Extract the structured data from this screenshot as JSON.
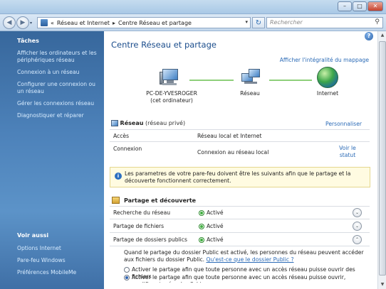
{
  "window": {
    "minimize_glyph": "–",
    "maximize_glyph": "□",
    "close_glyph": "✕"
  },
  "address": {
    "back_glyph": "◀",
    "forward_glyph": "▶",
    "overflow": "«",
    "crumbs": [
      "Réseau et Internet",
      "Centre Réseau et partage"
    ],
    "separator": "▸",
    "dropdown_glyph": "▾",
    "refresh_glyph": "↻",
    "search_placeholder": "Rechercher",
    "search_glyph": "⚲"
  },
  "sidebar": {
    "tasks_header": "Tâches",
    "tasks": [
      "Afficher les ordinateurs et les périphériques réseau",
      "Connexion à un réseau",
      "Configurer une connexion ou un réseau",
      "Gérer les connexions réseau",
      "Diagnostiquer et réparer"
    ],
    "see_also_header": "Voir aussi",
    "see_also": [
      "Options Internet",
      "Pare-feu Windows",
      "Préférences MobileMe"
    ]
  },
  "main": {
    "help_glyph": "?",
    "title": "Centre Réseau et partage",
    "view_full_map": "Afficher l'intégralité du mappage",
    "nodes": {
      "computer_name": "PC-DE-YVESROGER",
      "computer_sub": "(cet ordinateur)",
      "network": "Réseau",
      "internet": "Internet"
    },
    "network": {
      "name": "Réseau",
      "type": "(réseau privé)",
      "customize": "Personnaliser",
      "rows": [
        {
          "label": "Accès",
          "value": "Réseau local et Internet"
        },
        {
          "label": "Connexion",
          "value": "Connexion au réseau local"
        }
      ],
      "view_status": "Voir le statut"
    },
    "warning": {
      "icon": "i",
      "text": "Les parametres de votre pare-feu doivent être les suivants afin que le partage et la découverte fonctionnent correctement."
    },
    "sharing": {
      "title": "Partage et découverte",
      "rows": [
        {
          "label": "Recherche du réseau",
          "status": "Activé",
          "chevron": "⌄"
        },
        {
          "label": "Partage de fichiers",
          "status": "Activé",
          "chevron": "⌄"
        },
        {
          "label": "Partage de dossiers publics",
          "status": "Activé",
          "chevron": "⌃"
        }
      ],
      "detail_text": "Quand le partage du dossier Public est activé, les personnes du réseau peuvent accéder aux fichiers du dossier Public.",
      "detail_link": "Qu'est-ce que le dossier Public ?",
      "options": [
        {
          "label": "Activer le partage afin que toute personne avec un accès réseau puisse ouvrir des fichiers",
          "selected": false
        },
        {
          "label": "Activer le partage afin que toute personne avec un accès réseau puisse ouvrir, modifier et créer des fichiers",
          "selected": true
        }
      ]
    }
  },
  "colors": {
    "link": "#2a6ab6",
    "title": "#1b4d8c",
    "active": "#3fae3f",
    "sidebar": "#4d82ba"
  }
}
